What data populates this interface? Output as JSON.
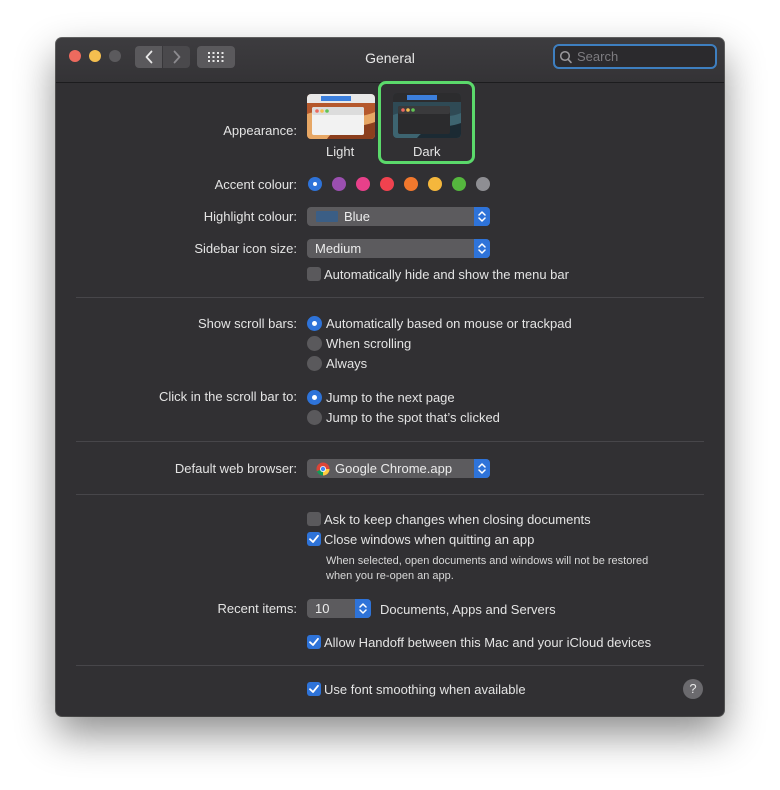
{
  "window": {
    "title": "General"
  },
  "search": {
    "placeholder": "Search"
  },
  "appearance": {
    "label": "Appearance:",
    "options": [
      {
        "label": "Light",
        "selected": false
      },
      {
        "label": "Dark",
        "selected": true
      }
    ]
  },
  "accent": {
    "label": "Accent colour:",
    "colors": [
      "#2e73d9",
      "#9b4fb0",
      "#e8408a",
      "#f0424f",
      "#f2782d",
      "#f5b73c",
      "#55b73e",
      "#8e8e93"
    ],
    "selected": "#2e73d9"
  },
  "highlight": {
    "label": "Highlight colour:",
    "value": "Blue",
    "swatch": "#3b5e85"
  },
  "sidebar_icon_size": {
    "label": "Sidebar icon size:",
    "value": "Medium"
  },
  "menu_bar": {
    "label": "Automatically hide and show the menu bar",
    "checked": false
  },
  "scroll_bars": {
    "label": "Show scroll bars:",
    "options": [
      "Automatically based on mouse or trackpad",
      "When scrolling",
      "Always"
    ],
    "selected_index": 0
  },
  "click_scroll": {
    "label": "Click in the scroll bar to:",
    "options": [
      "Jump to the next page",
      "Jump to the spot that’s clicked"
    ],
    "selected_index": 0
  },
  "browser": {
    "label": "Default web browser:",
    "value": "Google Chrome.app"
  },
  "documents": {
    "ask_keep_changes": {
      "label": "Ask to keep changes when closing documents",
      "checked": false
    },
    "close_windows": {
      "label": "Close windows when quitting an app",
      "checked": true
    },
    "close_windows_note_1": "When selected, open documents and windows will not be restored",
    "close_windows_note_2": "when you re-open an app."
  },
  "recent_items": {
    "label": "Recent items:",
    "value": "10",
    "suffix": "Documents, Apps and Servers"
  },
  "handoff": {
    "label": "Allow Handoff between this Mac and your iCloud devices",
    "checked": true
  },
  "font_smoothing": {
    "label": "Use font smoothing when available",
    "checked": true
  },
  "help": {
    "label": "?"
  }
}
